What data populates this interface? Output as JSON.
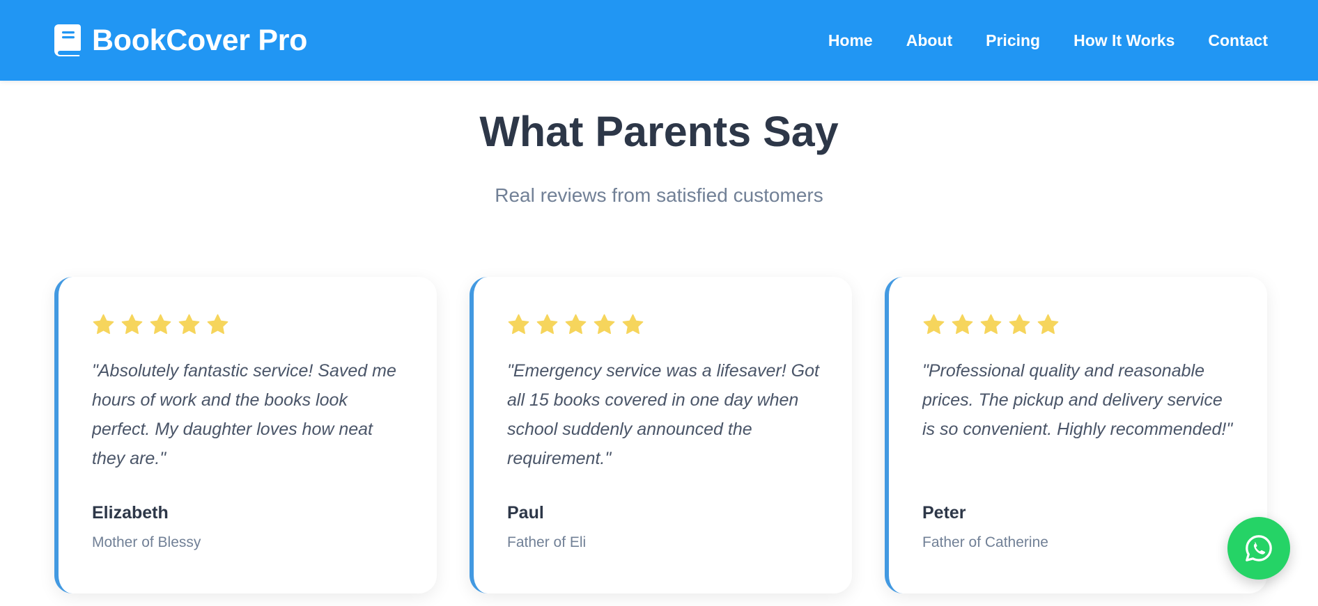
{
  "brand": {
    "name": "BookCover Pro",
    "icon": "book-icon"
  },
  "nav": {
    "items": [
      {
        "label": "Home"
      },
      {
        "label": "About"
      },
      {
        "label": "Pricing"
      },
      {
        "label": "How It Works"
      },
      {
        "label": "Contact"
      }
    ]
  },
  "testimonials": {
    "title": "What Parents Say",
    "subtitle": "Real reviews from satisfied customers",
    "items": [
      {
        "rating": 5,
        "quote": "\"Absolutely fantastic service! Saved me hours of work and the books look perfect. My daughter loves how neat they are.\"",
        "author": "Elizabeth",
        "relation": "Mother of Blessy"
      },
      {
        "rating": 5,
        "quote": "\"Emergency service was a lifesaver! Got all 15 books covered in one day when school suddenly announced the requirement.\"",
        "author": "Paul",
        "relation": "Father of Eli"
      },
      {
        "rating": 5,
        "quote": "\"Professional quality and reasonable prices. The pickup and delivery service is so convenient. Highly recommended!\"",
        "author": "Peter",
        "relation": "Father of Catherine"
      }
    ]
  },
  "colors": {
    "nav_background": "#2196f3",
    "card_accent": "#4299e1",
    "star": "#f6d55c",
    "whatsapp": "#25d366",
    "heading": "#2d3748",
    "muted": "#718096"
  },
  "whatsapp_button": {
    "icon": "whatsapp-icon"
  }
}
